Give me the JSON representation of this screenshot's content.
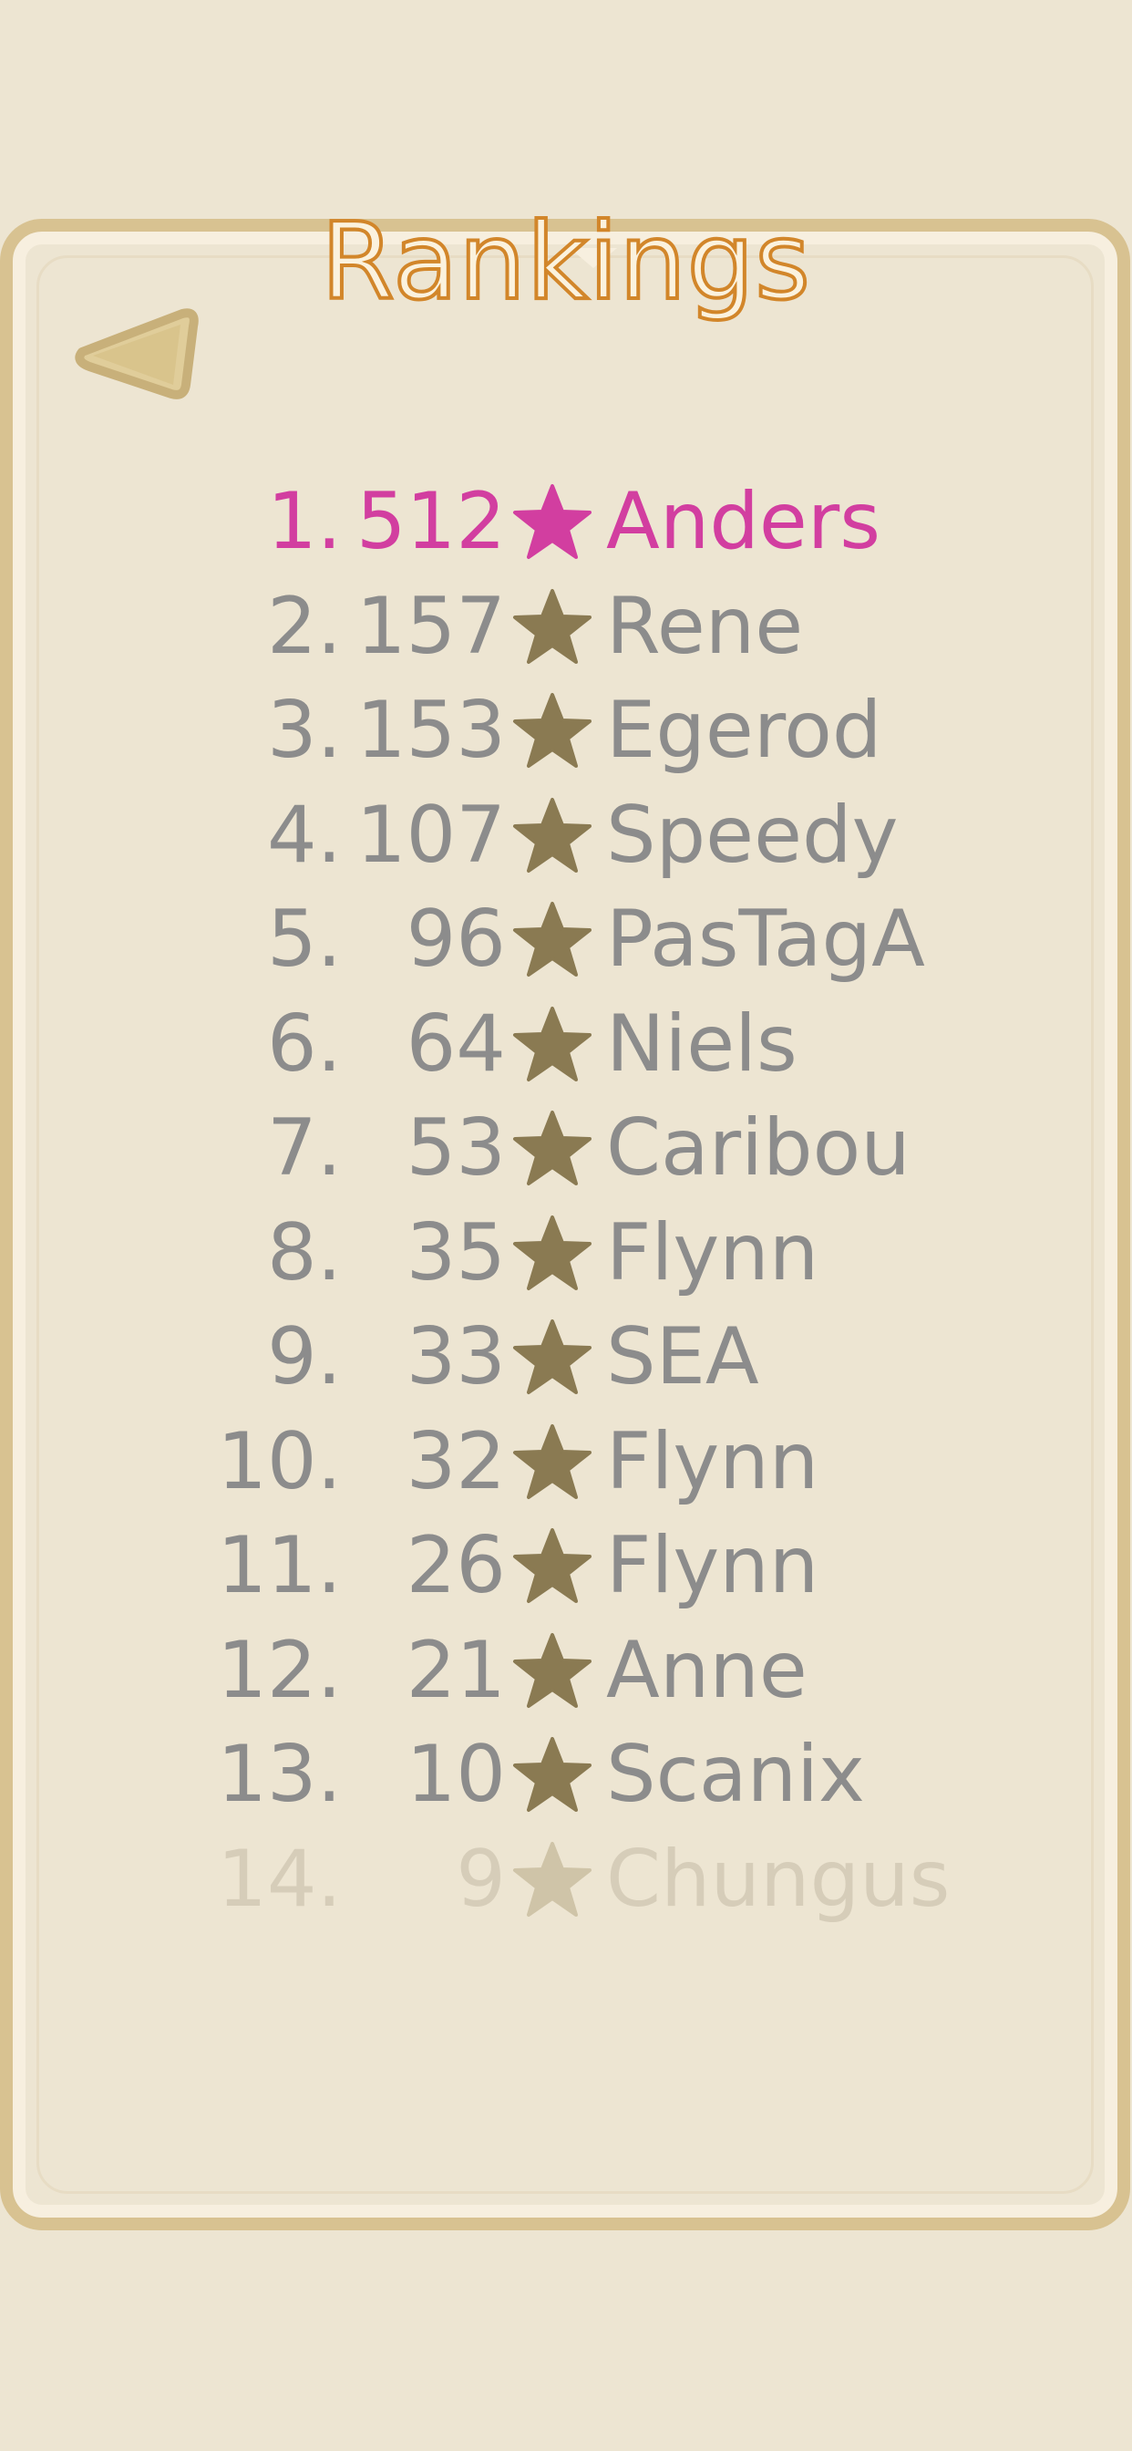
{
  "title": "Rankings",
  "back_icon": "back-arrow-icon",
  "colors": {
    "background": "#ede5d2",
    "frame": "#d8c291",
    "title_stroke": "#d2862a",
    "first_place": "#d23ea0",
    "text": "#8c8c8c",
    "star": "#8a7a52",
    "faded_text": "#d6cdb9",
    "faded_star": "#cfc4a8"
  },
  "rankings": [
    {
      "rank": "1.",
      "score": "512",
      "name": "Anders"
    },
    {
      "rank": "2.",
      "score": "157",
      "name": "Rene"
    },
    {
      "rank": "3.",
      "score": "153",
      "name": "Egerod"
    },
    {
      "rank": "4.",
      "score": "107",
      "name": "Speedy"
    },
    {
      "rank": "5.",
      "score": "96",
      "name": "PasTagA"
    },
    {
      "rank": "6.",
      "score": "64",
      "name": "Niels"
    },
    {
      "rank": "7.",
      "score": "53",
      "name": "Caribou"
    },
    {
      "rank": "8.",
      "score": "35",
      "name": "Flynn"
    },
    {
      "rank": "9.",
      "score": "33",
      "name": "SEA"
    },
    {
      "rank": "10.",
      "score": "32",
      "name": "Flynn"
    },
    {
      "rank": "11.",
      "score": "26",
      "name": "Flynn"
    },
    {
      "rank": "12.",
      "score": "21",
      "name": "Anne"
    },
    {
      "rank": "13.",
      "score": "10",
      "name": "Scanix"
    },
    {
      "rank": "14.",
      "score": "9",
      "name": "Chungus"
    }
  ]
}
